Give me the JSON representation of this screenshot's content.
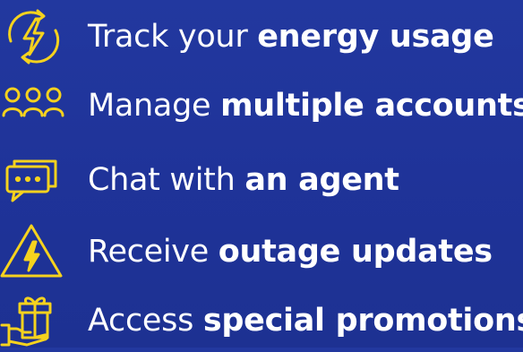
{
  "colors": {
    "background": "#1f349c",
    "icon": "#f5d21e",
    "text": "#ffffff"
  },
  "features": [
    {
      "icon": "energy-cycle-bolt-icon",
      "regular": "Track your ",
      "bold": "energy usage"
    },
    {
      "icon": "people-group-icon",
      "regular": "Manage ",
      "bold": "multiple accounts"
    },
    {
      "icon": "chat-bubbles-icon",
      "regular": "Chat with ",
      "bold": "an agent"
    },
    {
      "icon": "warning-bolt-icon",
      "regular": "Receive ",
      "bold": "outage updates"
    },
    {
      "icon": "gift-hand-icon",
      "regular": "Access ",
      "bold": "special promotions"
    }
  ]
}
